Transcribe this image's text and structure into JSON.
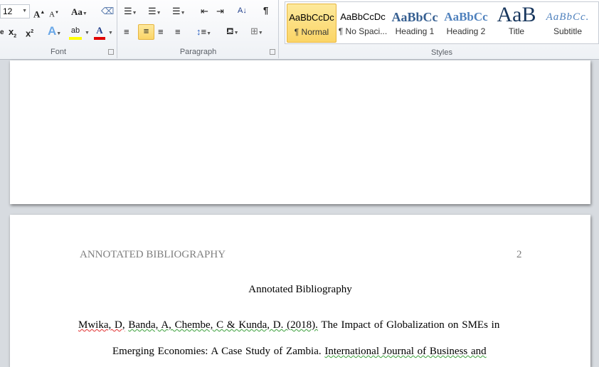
{
  "ribbon": {
    "font": {
      "label": "Font",
      "size": "12"
    },
    "paragraph": {
      "label": "Paragraph",
      "align_selected": "center"
    },
    "styles": {
      "label": "Styles",
      "items": [
        {
          "preview": "AaBbCcDc",
          "name": "¶ Normal",
          "selected": true
        },
        {
          "preview": "AaBbCcDc",
          "name": "¶ No Spaci..."
        },
        {
          "preview": "AaBbCc",
          "name": "Heading 1"
        },
        {
          "preview": "AaBbCc",
          "name": "Heading 2"
        },
        {
          "preview": "AaB",
          "name": "Title"
        },
        {
          "preview": "AaBbCc.",
          "name": "Subtitle"
        }
      ]
    },
    "colors": {
      "highlight": "#ffff00",
      "font_color": "#e00000",
      "selected": "#fbd567"
    }
  },
  "document": {
    "header_left": "ANNOTATED BIBLIOGRAPHY",
    "page_number": "2",
    "title": "Annotated Bibliography",
    "ref_authors_1": "Mwika, D,",
    "ref_authors_2": "Banda, A, Chembe, C & Kunda, D. (2018).",
    "ref_text_1": "The Impact of Globalization on SMEs in",
    "ref_text_2": "Emerging Economies: A Case Study of Zambia.",
    "ref_journal": "International Journal of Business and"
  }
}
